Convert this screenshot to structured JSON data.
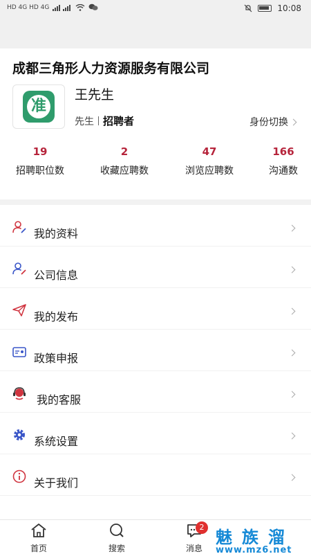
{
  "status_bar": {
    "network_left": "HD 4G HD 4G",
    "time": "10:08"
  },
  "profile": {
    "company": "成都三角形人力资源服务有限公司",
    "logo_char": "准",
    "name": "王先生",
    "title": "先生",
    "role": "招聘者",
    "identity_switch": "身份切换"
  },
  "stats": [
    {
      "value": "19",
      "label": "招聘职位数"
    },
    {
      "value": "2",
      "label": "收藏应聘数"
    },
    {
      "value": "47",
      "label": "浏览应聘数"
    },
    {
      "value": "166",
      "label": "沟通数"
    }
  ],
  "menu": [
    {
      "label": "我的资料",
      "icon": "user-edit-icon"
    },
    {
      "label": "公司信息",
      "icon": "company-user-icon"
    },
    {
      "label": "我的发布",
      "icon": "paper-plane-icon"
    },
    {
      "label": "政策申报",
      "icon": "id-card-icon"
    },
    {
      "label": "我的客服",
      "icon": "headset-icon"
    },
    {
      "label": "系统设置",
      "icon": "gear-icon"
    },
    {
      "label": "关于我们",
      "icon": "info-icon"
    }
  ],
  "tabbar": [
    {
      "label": "首页",
      "icon": "home-icon"
    },
    {
      "label": "搜索",
      "icon": "search-icon"
    },
    {
      "label": "消息",
      "icon": "message-icon",
      "badge": "2"
    }
  ],
  "watermark": {
    "top": "魅族溜",
    "bottom": "www.mz6.net"
  },
  "colors": {
    "accent_red": "#b6243b",
    "logo_green": "#2f9c6c",
    "badge_red": "#e0302f"
  }
}
